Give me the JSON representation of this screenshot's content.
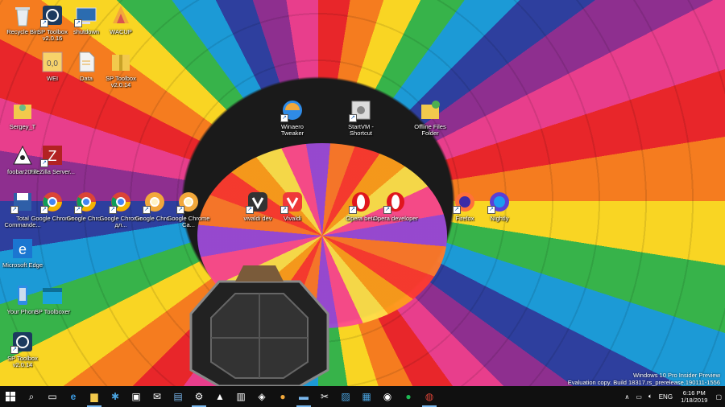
{
  "desktop_icons": [
    {
      "label": "Recycle Bin",
      "icon": "recycle-bin-icon"
    },
    {
      "label": "SP Toolbox v2.0.16",
      "icon": "sp-toolbox-icon"
    },
    {
      "label": "shutdown",
      "icon": "shutdown-icon"
    },
    {
      "label": "WACUP",
      "icon": "wacup-icon"
    },
    {
      "label": "WEI",
      "icon": "wei-icon"
    },
    {
      "label": "Data",
      "icon": "data-file-icon"
    },
    {
      "label": "SP Toolbox v2.0.14",
      "icon": "zip-folder-icon"
    },
    {
      "label": "Sergey_T",
      "icon": "user-folder-icon"
    },
    {
      "label": "foobar2000",
      "icon": "foobar-icon"
    },
    {
      "label": "FileZilla Server...",
      "icon": "filezilla-icon"
    },
    {
      "label": "Total Commande...",
      "icon": "total-commander-icon"
    },
    {
      "label": "Microsoft Edge",
      "icon": "edge-icon"
    },
    {
      "label": "Your Phone",
      "icon": "phone-icon"
    },
    {
      "label": "SP Toolboxer",
      "icon": "sp-toolboxer-icon"
    },
    {
      "label": "SP Toolbox v2.0.14",
      "icon": "sp-toolbox-icon"
    },
    {
      "label": "Winaero Tweaker",
      "icon": "winaero-icon"
    },
    {
      "label": "StartVM - Shortcut",
      "icon": "startvm-icon"
    },
    {
      "label": "Offline Files Folder",
      "icon": "offline-folder-icon"
    },
    {
      "label": "Google Chrome",
      "icon": "chrome-icon"
    },
    {
      "label": "Google Chro...",
      "icon": "chrome-beta-icon"
    },
    {
      "label": "Google Chrome дл...",
      "icon": "chrome-dev-icon"
    },
    {
      "label": "Google Chro...",
      "icon": "chrome-canary-icon"
    },
    {
      "label": "Google Chrome Ca...",
      "icon": "chrome-canary-icon"
    },
    {
      "label": "vivaldi dev",
      "icon": "vivaldi-dev-icon"
    },
    {
      "label": "Vivaldi",
      "icon": "vivaldi-icon"
    },
    {
      "label": "Opera beta",
      "icon": "opera-beta-icon"
    },
    {
      "label": "Opera developer",
      "icon": "opera-dev-icon"
    },
    {
      "label": "Firefox",
      "icon": "firefox-icon"
    },
    {
      "label": "Nightly",
      "icon": "nightly-icon"
    }
  ],
  "watermark": {
    "line1": "Windows 10 Pro Insider Preview",
    "line2": "Evaluation copy. Build 18317.rs_prerelease.190111-1556"
  },
  "taskbar": {
    "start": "start-icon",
    "apps": [
      "search-icon",
      "task-view-icon",
      "edge-icon",
      "file-explorer-icon",
      "sp-toolbox-icon",
      "store-icon",
      "mail-icon",
      "save-icon",
      "settings-icon",
      "foobar-icon",
      "terminal-icon",
      "defender-icon",
      "chrome-canary-icon",
      "folder-icon",
      "snipping-icon",
      "photos-icon",
      "store-bag-icon",
      "network-icon",
      "spotify-icon",
      "chrome-icon"
    ],
    "tray": {
      "lang": "ENG",
      "time": "6:16 PM",
      "date": "1/18/2019"
    }
  },
  "colors": {
    "taskbar": "#101010",
    "accent": "#7ab8ee"
  }
}
